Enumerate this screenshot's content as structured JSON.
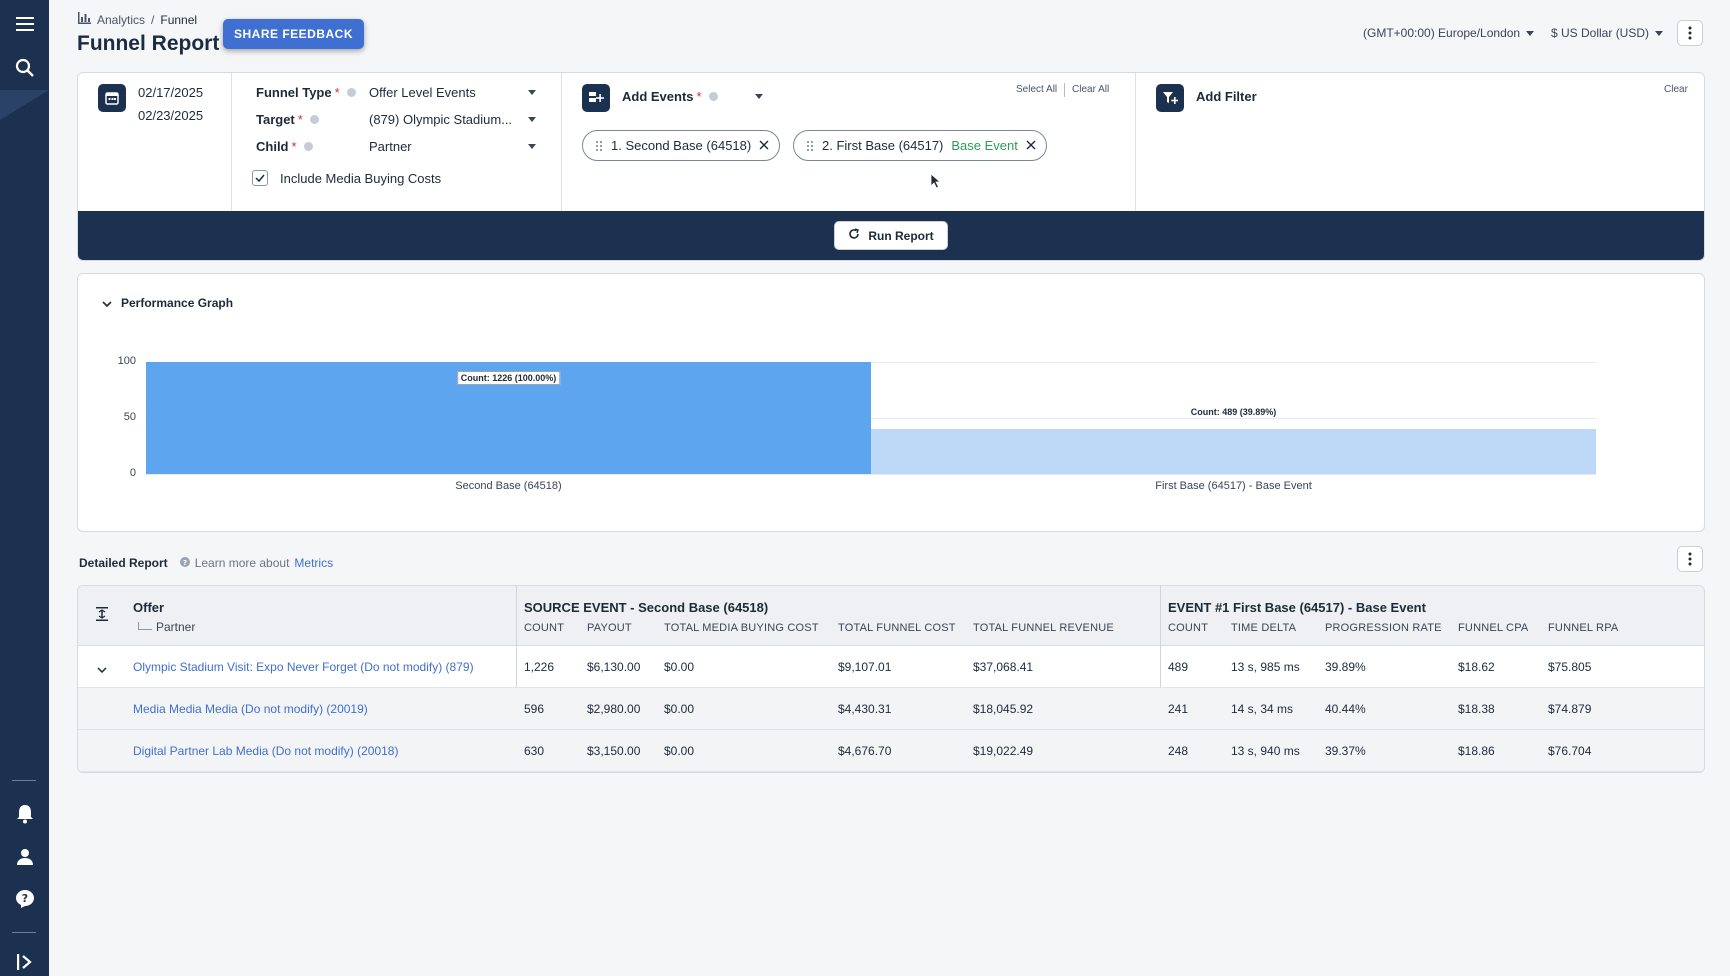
{
  "breadcrumb": {
    "root": "Analytics",
    "sep": "/",
    "current": "Funnel"
  },
  "page": {
    "title": "Funnel Report",
    "feedback_label": "SHARE FEEDBACK"
  },
  "top_right": {
    "timezone": "(GMT+00:00) Europe/London",
    "currency": "$ US Dollar (USD)"
  },
  "config": {
    "date_start": "02/17/2025",
    "date_end": "02/23/2025",
    "funnel_type_label": "Funnel Type",
    "funnel_type_value": "Offer Level Events",
    "target_label": "Target",
    "target_value": "(879) Olympic Stadium...",
    "child_label": "Child",
    "child_value": "Partner",
    "required_mark": "*",
    "include_media_label": "Include Media Buying Costs",
    "include_media_checked": true,
    "add_events_label": "Add Events",
    "select_all": "Select All",
    "clear_all": "Clear All",
    "events": [
      {
        "label": "1. Second Base (64518)",
        "tag": ""
      },
      {
        "label": "2. First Base (64517)",
        "tag": "Base Event"
      }
    ],
    "add_filter_label": "Add Filter",
    "clear_label": "Clear",
    "run_label": "Run Report"
  },
  "graph": {
    "title": "Performance Graph"
  },
  "chart_data": {
    "type": "bar",
    "categories": [
      "Second Base (64518)",
      "First Base (64517) - Base Event"
    ],
    "values": [
      100,
      39.89
    ],
    "labels": [
      "Count: 1226 (100.00%)",
      "Count: 489 (39.89%)"
    ],
    "yticks": [
      "100",
      "50",
      "0"
    ],
    "ylim": [
      0,
      100
    ],
    "colors": [
      "#5ea5ef",
      "#bdd9f7"
    ],
    "grid": true
  },
  "detail": {
    "title": "Detailed Report",
    "learn_prefix": "Learn more about",
    "learn_link": "Metrics"
  },
  "table": {
    "offer_header": "Offer",
    "partner_header": "Partner",
    "source_title": "SOURCE EVENT - Second Base (64518)",
    "event_title": "EVENT #1 First Base (64517) - Base Event",
    "source_columns": [
      "COUNT",
      "PAYOUT",
      "TOTAL MEDIA BUYING COST",
      "TOTAL FUNNEL COST",
      "TOTAL FUNNEL REVENUE"
    ],
    "event_columns": [
      "COUNT",
      "TIME DELTA",
      "PROGRESSION RATE",
      "FUNNEL CPA",
      "FUNNEL RPA"
    ],
    "rows": [
      {
        "name": "Olympic Stadium Visit: Expo Never Forget (Do not modify) (879)",
        "cells": [
          "1,226",
          "$6,130.00",
          "$0.00",
          "$9,107.01",
          "$37,068.41",
          "489",
          "13 s, 985 ms",
          "39.89%",
          "$18.62",
          "$75.805"
        ]
      },
      {
        "name": "Media Media Media (Do not modify) (20019)",
        "cells": [
          "596",
          "$2,980.00",
          "$0.00",
          "$4,430.31",
          "$18,045.92",
          "241",
          "14 s, 34 ms",
          "40.44%",
          "$18.38",
          "$74.879"
        ]
      },
      {
        "name": "Digital Partner Lab Media (Do not modify) (20018)",
        "cells": [
          "630",
          "$3,150.00",
          "$0.00",
          "$4,676.70",
          "$19,022.49",
          "248",
          "13 s, 940 ms",
          "39.37%",
          "$18.86",
          "$76.704"
        ]
      }
    ]
  }
}
